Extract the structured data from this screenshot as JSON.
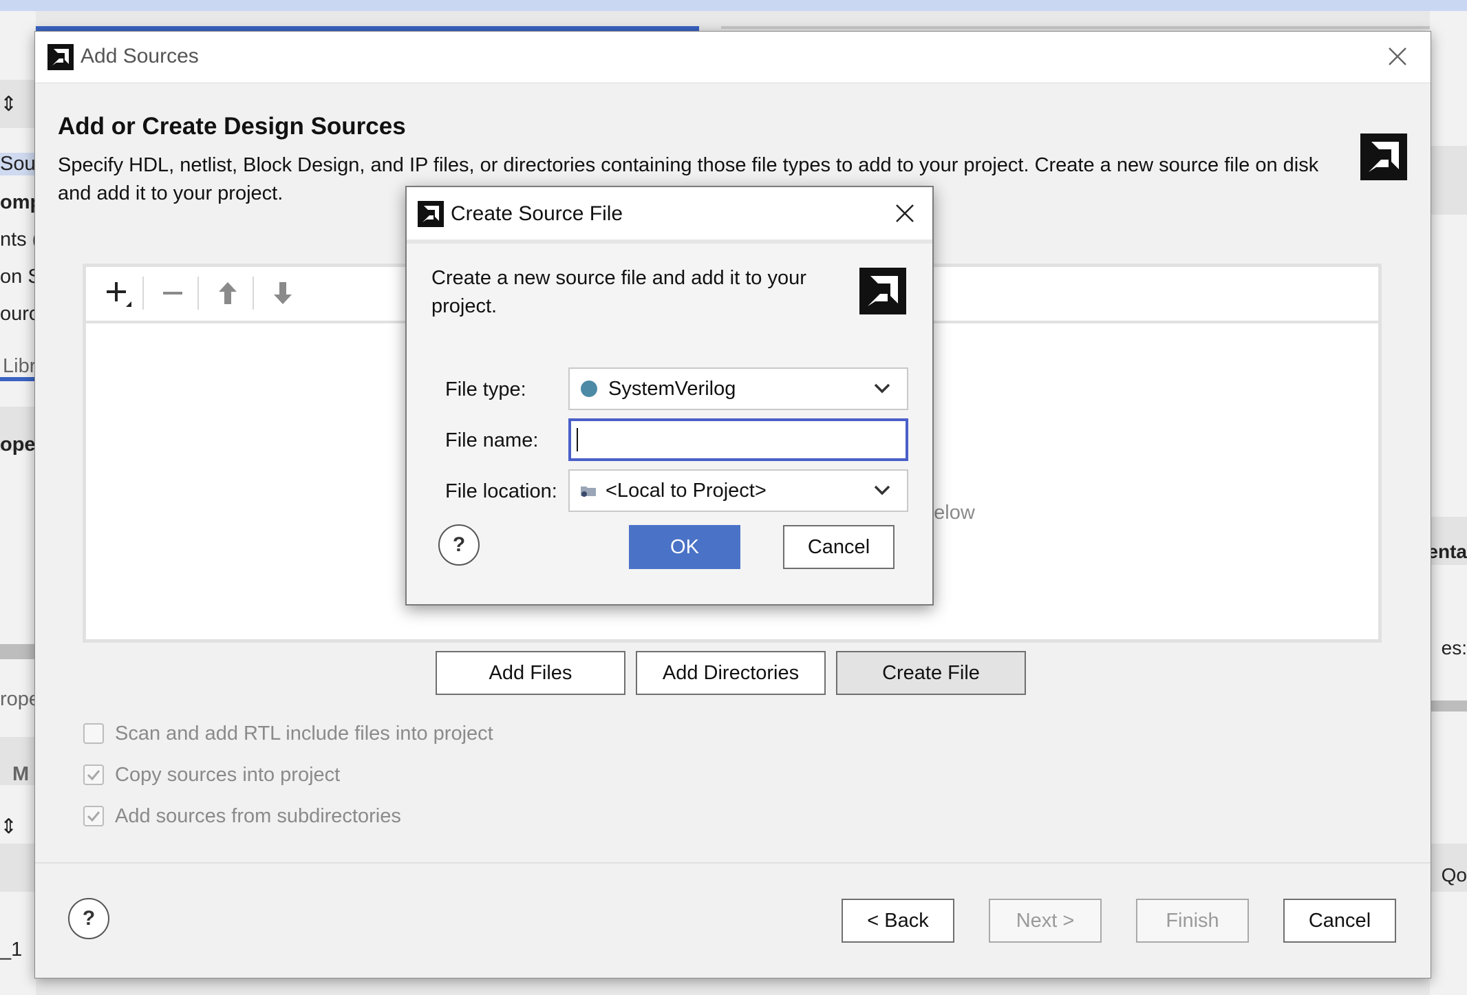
{
  "background": {
    "left_fragments": [
      "Sour",
      "omp",
      "nts (",
      "on S",
      "ourc",
      "Libr",
      "oper",
      "rope",
      "M",
      "_1"
    ],
    "right_fragments": [
      "enta",
      "es:",
      "Qo"
    ]
  },
  "dialog": {
    "title": "Add Sources",
    "heading": "Add or Create Design Sources",
    "description": "Specify HDL, netlist, Block Design, and IP files, or directories containing those file types to add to your project. Create a new source file on disk and add it to your project.",
    "empty_hint": "below",
    "buttons": {
      "add_files": "Add Files",
      "add_directories": "Add Directories",
      "create_file": "Create File"
    },
    "options": [
      {
        "label": "Scan and add RTL include files into project",
        "checked": false
      },
      {
        "label": "Copy sources into project",
        "checked": true
      },
      {
        "label": "Add sources from subdirectories",
        "checked": true
      }
    ],
    "help": "?",
    "nav": {
      "back": "< Back",
      "next": "Next >",
      "finish": "Finish",
      "cancel": "Cancel"
    }
  },
  "modal": {
    "title": "Create Source File",
    "description": "Create a new source file and add it to your project.",
    "fields": {
      "file_type_label": "File type:",
      "file_type_value": "SystemVerilog",
      "file_name_label": "File name:",
      "file_name_value": "",
      "file_location_label": "File location:",
      "file_location_value": "<Local to Project>"
    },
    "help": "?",
    "ok": "OK",
    "cancel": "Cancel"
  },
  "colors": {
    "accent": "#4a72c7",
    "focus_border": "#4a5fc9",
    "filetype_dot": "#4c8aa6"
  }
}
